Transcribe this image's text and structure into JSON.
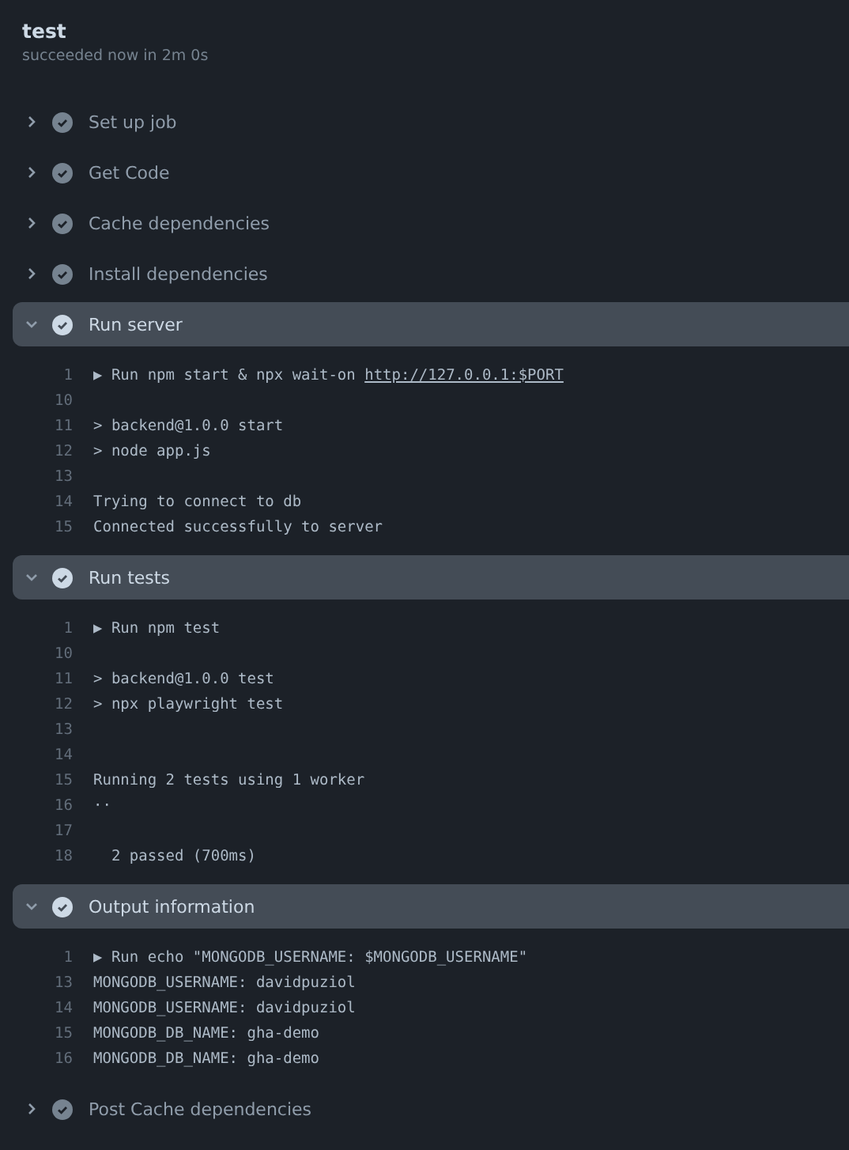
{
  "job": {
    "title": "test",
    "status": "succeeded now in 2m 0s"
  },
  "steps": [
    {
      "label": "Set up job",
      "expanded": false
    },
    {
      "label": "Get Code",
      "expanded": false
    },
    {
      "label": "Cache dependencies",
      "expanded": false
    },
    {
      "label": "Install dependencies",
      "expanded": false
    },
    {
      "label": "Run server",
      "expanded": true,
      "lines": [
        {
          "number": "1",
          "text": "▶ Run npm start & npx wait-on ",
          "link": "http://127.0.0.1:$PORT"
        },
        {
          "number": "10"
        },
        {
          "number": "11",
          "text": "> backend@1.0.0 start"
        },
        {
          "number": "12",
          "text": "> node app.js"
        },
        {
          "number": "13"
        },
        {
          "number": "14",
          "text": "Trying to connect to db"
        },
        {
          "number": "15",
          "text": "Connected successfully to server"
        }
      ]
    },
    {
      "label": "Run tests",
      "expanded": true,
      "lines": [
        {
          "number": "1",
          "text": "▶ Run npm test"
        },
        {
          "number": "10"
        },
        {
          "number": "11",
          "text": "> backend@1.0.0 test"
        },
        {
          "number": "12",
          "text": "> npx playwright test"
        },
        {
          "number": "13"
        },
        {
          "number": "14"
        },
        {
          "number": "15",
          "text": "Running 2 tests using 1 worker"
        },
        {
          "number": "16",
          "text": "··"
        },
        {
          "number": "17"
        },
        {
          "number": "18",
          "text": "  2 passed (700ms)"
        }
      ]
    },
    {
      "label": "Output information",
      "expanded": true,
      "lines": [
        {
          "number": "1",
          "text": "▶ Run echo \"MONGODB_USERNAME: $MONGODB_USERNAME\""
        },
        {
          "number": "13",
          "text": "MONGODB_USERNAME: davidpuziol"
        },
        {
          "number": "14",
          "text": "MONGODB_USERNAME: davidpuziol"
        },
        {
          "number": "15",
          "text": "MONGODB_DB_NAME: gha-demo"
        },
        {
          "number": "16",
          "text": "MONGODB_DB_NAME: gha-demo"
        }
      ]
    },
    {
      "label": "Post Cache dependencies",
      "expanded": false
    }
  ]
}
